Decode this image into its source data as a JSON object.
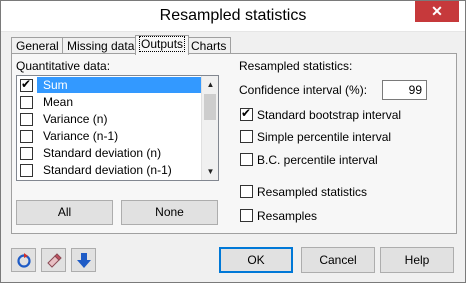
{
  "window": {
    "title": "Resampled statistics",
    "close_glyph": "✕"
  },
  "tabs": [
    {
      "label": "General",
      "active": false
    },
    {
      "label": "Missing data",
      "active": false
    },
    {
      "label": "Outputs",
      "active": true
    },
    {
      "label": "Charts",
      "active": false
    }
  ],
  "quantitative": {
    "label": "Quantitative data:",
    "items": [
      {
        "label": "Sum",
        "checked": true,
        "selected": true
      },
      {
        "label": "Mean",
        "checked": false,
        "selected": false
      },
      {
        "label": "Variance (n)",
        "checked": false,
        "selected": false
      },
      {
        "label": "Variance (n-1)",
        "checked": false,
        "selected": false
      },
      {
        "label": "Standard deviation (n)",
        "checked": false,
        "selected": false
      },
      {
        "label": "Standard deviation (n-1)",
        "checked": false,
        "selected": false
      }
    ],
    "all_label": "All",
    "none_label": "None"
  },
  "resampled": {
    "label": "Resampled statistics:",
    "ci_label": "Confidence interval (%):",
    "ci_value": "99",
    "options": [
      {
        "label": "Standard bootstrap interval",
        "checked": true
      },
      {
        "label": "Simple percentile interval",
        "checked": false
      },
      {
        "label": "B.C. percentile interval",
        "checked": false
      }
    ],
    "outputs": [
      {
        "label": "Resampled statistics",
        "checked": false
      },
      {
        "label": "Resamples",
        "checked": false
      }
    ]
  },
  "footer": {
    "ok_label": "OK",
    "cancel_label": "Cancel",
    "help_label": "Help"
  },
  "colors": {
    "accent": "#0078d7",
    "selection": "#3399ff",
    "close": "#c6393b",
    "arrow": "#1e5bc6"
  }
}
